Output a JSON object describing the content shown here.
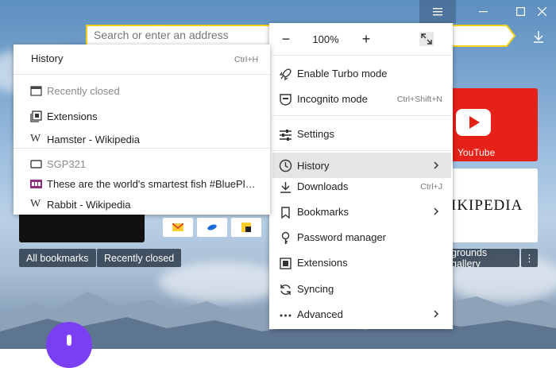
{
  "window": {
    "controls": [
      "menu",
      "minimize",
      "maximize",
      "close"
    ],
    "colors": {
      "address_border": "#f5d21a",
      "menu_highlight": "#e5e5e5",
      "youtube": "#e62117",
      "alice": "#7b3ff2"
    }
  },
  "address_bar": {
    "placeholder": "Search or enter an address",
    "value": ""
  },
  "main_menu": {
    "zoom": {
      "minus": "−",
      "value": "100%",
      "plus": "+"
    },
    "items": [
      {
        "label": "Enable Turbo mode",
        "icon": "rocket-icon",
        "shortcut": ""
      },
      {
        "label": "Incognito mode",
        "icon": "incognito-icon",
        "shortcut": "Ctrl+Shift+N"
      },
      {
        "label": "Settings",
        "icon": "settings-sliders-icon",
        "shortcut": ""
      },
      {
        "label": "History",
        "icon": "clock-icon",
        "shortcut": "",
        "submenu": true,
        "highlighted": true
      },
      {
        "label": "Downloads",
        "icon": "download-icon",
        "shortcut": "Ctrl+J"
      },
      {
        "label": "Bookmarks",
        "icon": "bookmark-icon",
        "shortcut": "",
        "submenu": true
      },
      {
        "label": "Password manager",
        "icon": "key-icon",
        "shortcut": ""
      },
      {
        "label": "Extensions",
        "icon": "extensions-icon",
        "shortcut": ""
      },
      {
        "label": "Syncing",
        "icon": "sync-icon",
        "shortcut": ""
      },
      {
        "label": "Advanced",
        "icon": "more-dots-icon",
        "shortcut": "",
        "submenu": true
      }
    ]
  },
  "history_submenu": {
    "title": "History",
    "title_shortcut": "Ctrl+H",
    "recently_closed_label": "Recently closed",
    "extensions_label": "Extensions",
    "item_hamster": "Hamster - Wikipedia",
    "group_label": "SGP321",
    "item_fish": "These are the world's smartest fish #BluePlane...",
    "item_rabbit": "Rabbit - Wikipedia"
  },
  "new_tab": {
    "tiles": {
      "youtube_label": "YouTube",
      "wiki_label": "IKIPEDIA"
    },
    "buttons": {
      "all_bookmarks": "All bookmarks",
      "recently_closed": "Recently closed",
      "gallery": "grounds gallery",
      "more": "⋮"
    }
  }
}
